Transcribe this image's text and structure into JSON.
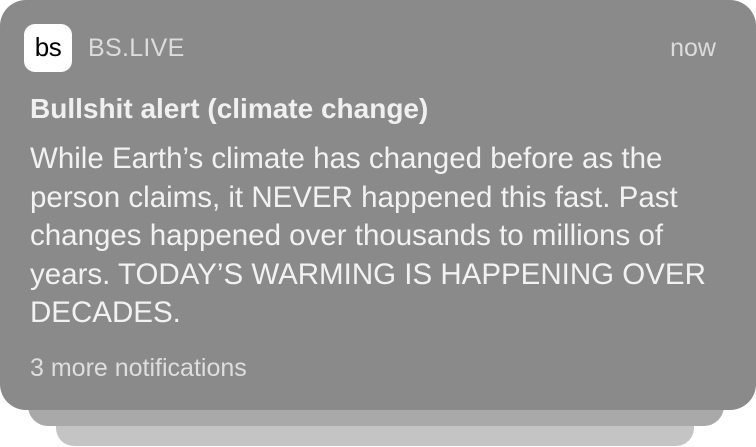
{
  "notification": {
    "app_icon_text": "bs",
    "app_name": "BS.LIVE",
    "timestamp": "now",
    "title": "Bullshit alert (climate change)",
    "body": "While Earth’s climate has changed before as the person claims, it NEVER happened this fast. Past changes happened over thousands to millions of years. TODAY’S WARMING IS HAPPENING OVER DECADES.",
    "more_notifications": "3 more notifications"
  },
  "colors": {
    "card_background": "#8a8a8a",
    "stack_layer_1": "#a9a9a9",
    "stack_layer_2": "#c4c4c4",
    "icon_background": "#ffffff"
  }
}
